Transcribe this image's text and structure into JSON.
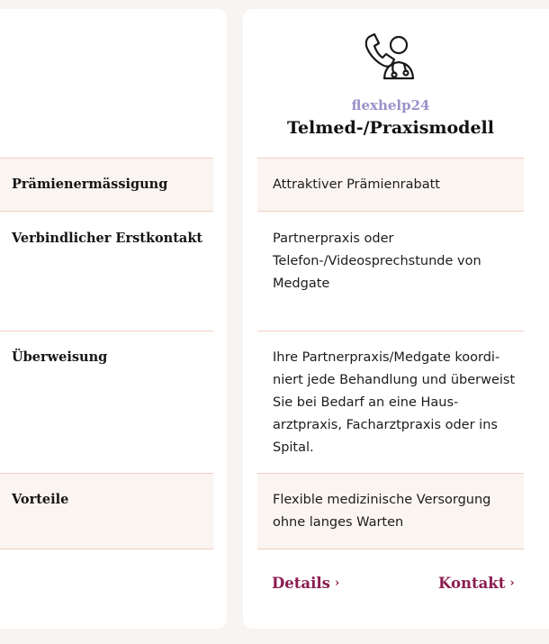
{
  "plan": {
    "brand": "flexhelp24",
    "title": "Telmed-/Praxismodell",
    "icon": "doctor-phone-icon"
  },
  "rows": [
    {
      "label": "Prämienermässigung",
      "value": "Attraktiver Prämienrabatt"
    },
    {
      "label": "Verbindlicher Erstkontakt",
      "value": "Partnerpraxis oder Telefon-/Videosprechstunde von Medgate"
    },
    {
      "label": "Überweisung",
      "value": "Ihre Partnerpraxis/Medgate koordi­niert jede Behandlung und über­weist Sie bei Bedarf an eine Haus­arztpraxis, Facharztpraxis oder ins Spital."
    },
    {
      "label": "Vorteile",
      "value": "Flexible medizinische Versorgung ohne langes Warten"
    }
  ],
  "links": {
    "details": "Details",
    "kontakt": "Kontakt",
    "chevron": "›"
  },
  "colors": {
    "accent": "#8c1d52",
    "brand": "#9a92c9",
    "band": "#fbf5f1",
    "rule": "#f0cfc0"
  }
}
